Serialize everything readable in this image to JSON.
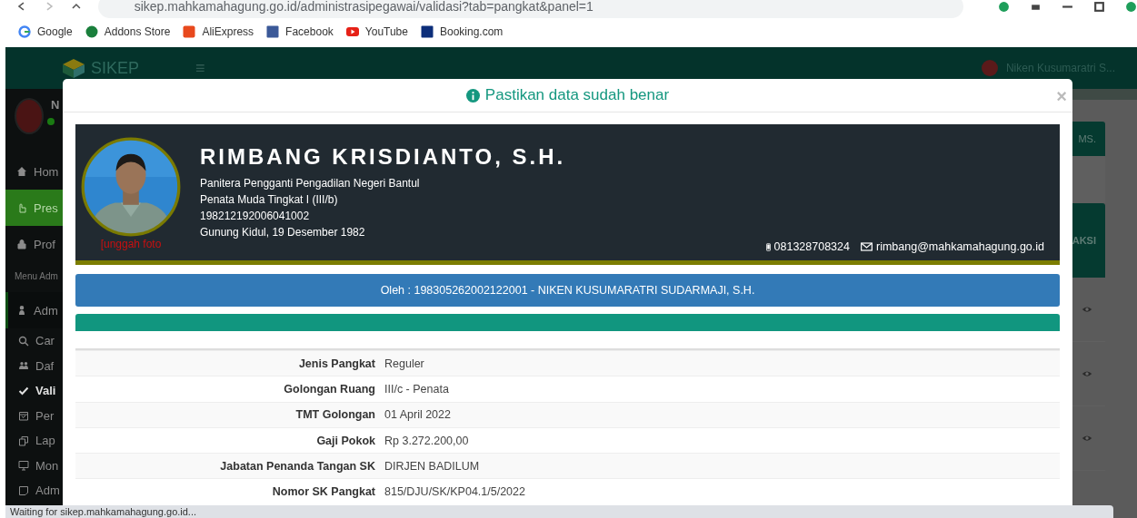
{
  "browser": {
    "url": "sikep.mahkamahagung.go.id/administrasipegawai/validasi?tab=pangkat&panel=1",
    "bookmarks": [
      {
        "label": "Google",
        "kind": "google"
      },
      {
        "label": "Addons Store",
        "kind": "addons"
      },
      {
        "label": "AliExpress",
        "kind": "aliexpress"
      },
      {
        "label": "Facebook",
        "kind": "facebook"
      },
      {
        "label": "YouTube",
        "kind": "youtube"
      },
      {
        "label": "Booking.com",
        "kind": "booking"
      }
    ]
  },
  "app": {
    "logo": "SIKEP",
    "menu_icon": "≡",
    "user": "Niken Kusumaratri S...",
    "sidebar_user": "N",
    "sidebar": [
      {
        "label": "Hom",
        "kind": "item",
        "selected": false
      },
      {
        "label": "Pres",
        "kind": "item",
        "selected": true
      },
      {
        "label": "Prof",
        "kind": "item",
        "selected": false
      },
      {
        "label": "Menu Adm",
        "kind": "header"
      },
      {
        "label": "Adm",
        "kind": "group",
        "selected": false
      },
      {
        "label": "Car",
        "kind": "subitem",
        "selected": false
      },
      {
        "label": "Daf",
        "kind": "subitem",
        "selected": false
      },
      {
        "label": "Vali",
        "kind": "subitem",
        "selected": true
      },
      {
        "label": "Per",
        "kind": "subitem",
        "selected": false
      },
      {
        "label": "Lap",
        "kind": "subitem",
        "selected": false
      },
      {
        "label": "Mon",
        "kind": "subitem",
        "selected": false
      },
      {
        "label": "Adm",
        "kind": "subitem",
        "selected": false
      }
    ],
    "table_headers": [
      "MS.",
      "AKSI"
    ],
    "row_actions": [
      {
        "kind": "view"
      },
      {
        "kind": "view"
      },
      {
        "kind": "view"
      }
    ]
  },
  "modal": {
    "title": "Pastikan data sudah benar",
    "close": "×",
    "profile": {
      "upload_link": "[unggah foto",
      "name": "RIMBANG KRISDIANTO, S.H.",
      "lines": [
        "Panitera Pengganti Pengadilan Negeri Bantul",
        "Penata Muda Tingkat I (III/b)",
        "198212192006041002",
        "Gunung Kidul, 19 Desember 1982"
      ],
      "phone": "081328708324",
      "email": "rimbang@mahkamahagung.go.id"
    },
    "by_bar": "Oleh : 198305262002122001 - NIKEN KUSUMARATRI SUDARMAJI, S.H.",
    "details": [
      {
        "label": "Jenis Pangkat",
        "value": "Reguler"
      },
      {
        "label": "Golongan Ruang",
        "value": "III/c - Penata"
      },
      {
        "label": "TMT Golongan",
        "value": "01 April 2022"
      },
      {
        "label": "Gaji Pokok",
        "value": "Rp 3.272.200,00"
      },
      {
        "label": "Jabatan Penanda Tangan SK",
        "value": "DIRJEN BADILUM"
      },
      {
        "label": "Nomor SK Pangkat",
        "value": "815/DJU/SK/KP04.1/5/2022"
      }
    ]
  },
  "status_bar": "Waiting for sikep.mahkamahagung.go.id..."
}
